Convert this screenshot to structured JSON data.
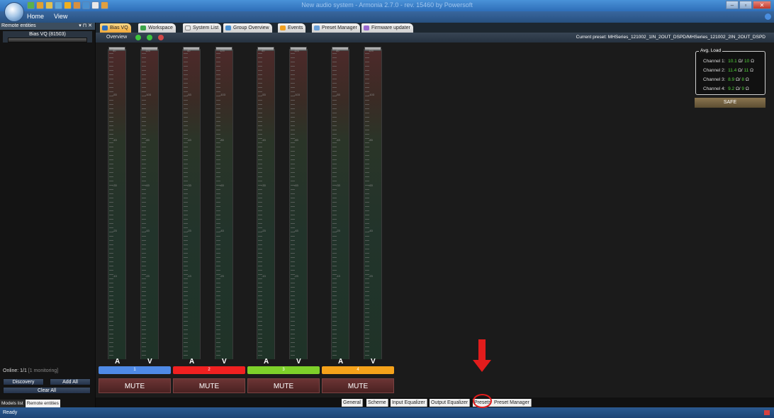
{
  "window": {
    "title": "New audio system - Armonia 2.7.0 - rev. 15460 by Powersoft"
  },
  "ribbon": {
    "home": "Home",
    "view": "View"
  },
  "sidebar": {
    "header": "Remote entities",
    "controls": "▾ ⊓ ✕",
    "entity_name": "Bias VQ (81503)",
    "online_label": "Online: 1/1",
    "online_detail": "[1 monitoring]",
    "discovery": "Discovery",
    "add_all": "Add All",
    "clear_all": "Clear All",
    "tabs": [
      "Models list",
      "Remote entities"
    ]
  },
  "doc_tabs": [
    "Bias VQ",
    "Workspace",
    "System List",
    "Group Overview",
    "Events",
    "Preset Manager",
    "Firmware updater"
  ],
  "subbar": {
    "overview": "Overview",
    "current_preset": "Current preset: MHSeries_121002_1IN_2OUT_DSPD/MHSeries_121002_2IN_2OUT_DSPD"
  },
  "meters": {
    "a_label": "A",
    "v_label": "V",
    "a_scale": [
      "50",
      "-53",
      "-43",
      "-33",
      "-23",
      "-13"
    ],
    "v_scale": [
      "125",
      "-103",
      "-83",
      "-63",
      "-43",
      "-23"
    ]
  },
  "channels": [
    {
      "number": "1",
      "color": "#4f8ae6",
      "mute": "MUTE"
    },
    {
      "number": "2",
      "color": "#f02020",
      "mute": "MUTE"
    },
    {
      "number": "3",
      "color": "#7ed02a",
      "mute": "MUTE"
    },
    {
      "number": "4",
      "color": "#f5a21a",
      "mute": "MUTE"
    }
  ],
  "avg_load": {
    "title": "Avg. Load",
    "rows": [
      {
        "label": "Channel 1:",
        "measured": "10.1",
        "nominal": "10"
      },
      {
        "label": "Channel 2:",
        "measured": "11.4",
        "nominal": "11"
      },
      {
        "label": "Channel 3:",
        "measured": "8.9",
        "nominal": "8"
      },
      {
        "label": "Channel 4:",
        "measured": "9.2",
        "nominal": "9"
      }
    ],
    "unit": "Ω",
    "safe": "SAFE"
  },
  "bottom_tabs": [
    "General",
    "Scheme",
    "Input Equalizer",
    "Output Equalizer",
    "Presets",
    "Preset Manager"
  ],
  "status": "Ready",
  "colors": {
    "accent": "#f1a93a",
    "annotation": "#e21c1c",
    "load_value": "#52d43a"
  }
}
